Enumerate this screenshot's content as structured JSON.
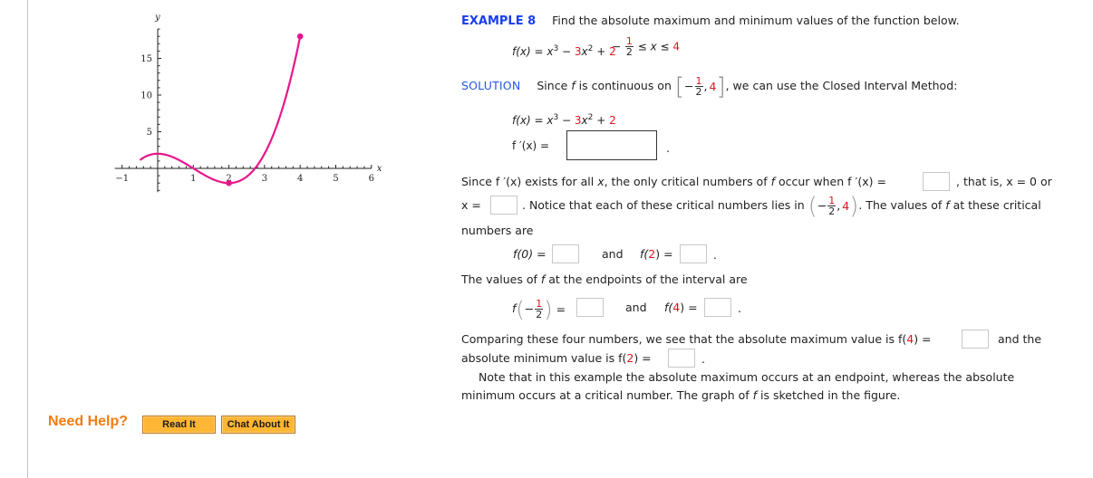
{
  "example": {
    "label": "EXAMPLE 8",
    "prompt": "Find the absolute maximum and minimum values of the function below.",
    "function_parts": [
      "f(x) = x",
      "3",
      " − ",
      "3",
      "x",
      "2",
      " + ",
      "2"
    ],
    "domain_parts": {
      "neg": "−",
      "num": "1",
      "den": "2",
      "rel": " ≤ x ≤ ",
      "upper": "4"
    }
  },
  "solution": {
    "label": "SOLUTION",
    "intro_pre": "Since ",
    "intro_f": "f",
    "intro_mid": " is continuous on",
    "interval": {
      "neg": "−",
      "num": "1",
      "den": "2",
      "sep": ",",
      "upper": "4",
      "open": "[",
      "close": "]"
    },
    "intro_post": ", we can use the Closed Interval Method:",
    "fx_label": "f(x)  =  x",
    "fx_exp3": "3",
    "fx_minus": " − ",
    "fx_coef": "3",
    "fx_x": "x",
    "fx_exp2": "2",
    "fx_plus": " + ",
    "fx_const": "2",
    "fpx_label": "f ′(x)  =",
    "fpx_dot": ".",
    "fpx_value": "",
    "crit_line1_a": "Since  f ′(x)  exists for all ",
    "crit_line1_x": "x",
    "crit_line1_b": ", the only critical numbers of ",
    "crit_line1_f": "f",
    "crit_line1_c": " occur when  f ′(x) =",
    "crit_line1_d": ",  that is,  x = 0  or",
    "crit_zero_value": "",
    "crit_line2_a": "x =",
    "crit_line2_b": ".  Notice that each of these critical numbers lies in",
    "open_interval": {
      "open": "(",
      "neg": "−",
      "num": "1",
      "den": "2",
      "sep": ",",
      "upper": "4",
      "close": ")"
    },
    "crit_line2_c": ". The values of ",
    "crit_line2_f": "f",
    "crit_line2_d": " at these critical",
    "crit_x_value": "",
    "crit_line3": "numbers are",
    "f0_label": "f(0)  =",
    "f0_value": "",
    "and": "and",
    "f2_label_pre": "f(",
    "f2_arg": "2",
    "f2_label_post": ")  =",
    "f2_value": "",
    "period": ".",
    "endpoints_pre": "The values of ",
    "endpoints_f": "f",
    "endpoints_post": " at the endpoints of the interval are",
    "fneg_label": "f",
    "fneg_neg": "−",
    "fneg_num": "1",
    "fneg_den": "2",
    "fneg_eq": "=",
    "fneg_value": "",
    "f4_label_pre": "f(",
    "f4_arg": "4",
    "f4_label_post": ")  =",
    "f4_value": "",
    "compare_a": "Comparing these four numbers, we see that the absolute maximum value is  f(",
    "compare_arg": "4",
    "compare_b": ") =",
    "compare_c": "and the",
    "max_value": "",
    "min_a": "absolute minimum value is  f(",
    "min_arg": "2",
    "min_b": ") =",
    "min_value": "",
    "note_line1": "Note that in this example the absolute maximum occurs at an endpoint, whereas the absolute",
    "note_line2_a": "minimum occurs at a critical number. The graph of ",
    "note_line2_f": "f",
    "note_line2_b": " is sketched in the figure."
  },
  "help": {
    "label": "Need Help?",
    "buttons": [
      {
        "label": "Read It"
      },
      {
        "label": "Chat About It"
      }
    ]
  },
  "colors": {
    "accent_blue": "#1a3ef0",
    "highlight_red": "#e0141e",
    "curve": "#e8168c",
    "help_orange": "#ef7d12",
    "button_fill": "#ffb634"
  },
  "chart_data": {
    "type": "line",
    "title": "",
    "xlabel": "x",
    "ylabel": "y",
    "function": "x^3 - 3x^2 + 2",
    "domain": [
      -0.5,
      4
    ],
    "xlim": [
      -1,
      6
    ],
    "ylim": [
      -3,
      19
    ],
    "x_ticks": [
      -1,
      1,
      2,
      3,
      4,
      5,
      6
    ],
    "x_tick_labels": [
      "−1",
      "1",
      "2",
      "3",
      "4",
      "5",
      "6"
    ],
    "y_ticks": [
      5,
      10,
      15
    ],
    "y_tick_labels": [
      "5",
      "10",
      "15"
    ],
    "grid": false,
    "series": [
      {
        "name": "f(x)",
        "color": "#e8168c"
      }
    ],
    "marked_points": [
      {
        "x": 4,
        "y": 18,
        "label": "absolute maximum"
      },
      {
        "x": 2,
        "y": -2,
        "label": "absolute minimum"
      }
    ]
  }
}
